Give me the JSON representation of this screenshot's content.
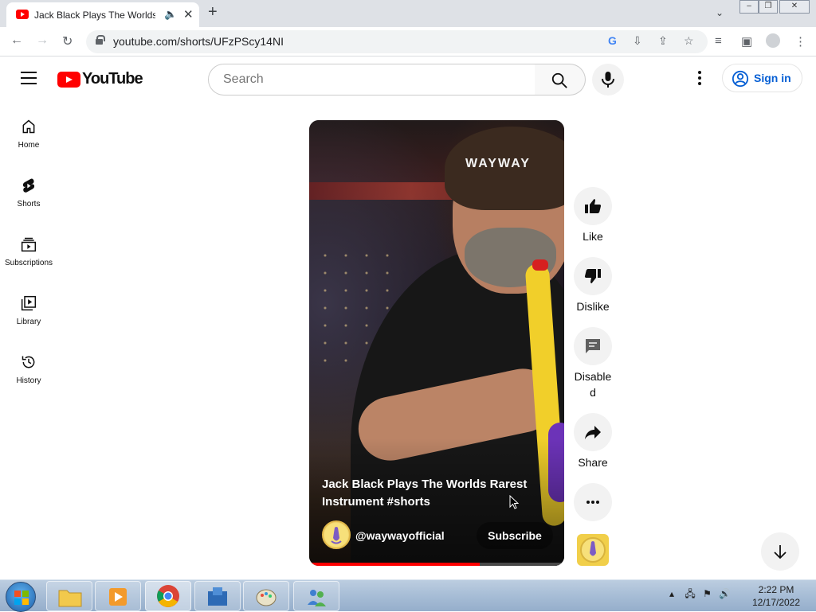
{
  "browser": {
    "tab_title": "Jack Black Plays The Worlds Rarest Instrument",
    "url": "youtube.com/shorts/UFzPScy14NI",
    "new_tab_glyph": "+",
    "close_tab_glyph": "✕"
  },
  "header": {
    "logo_text": "YouTube",
    "search_placeholder": "Search",
    "sign_in": "Sign in"
  },
  "sidebar": {
    "items": [
      {
        "label": "Home",
        "icon": "home-icon"
      },
      {
        "label": "Shorts",
        "icon": "shorts-icon"
      },
      {
        "label": "Subscriptions",
        "icon": "subscriptions-icon"
      },
      {
        "label": "Library",
        "icon": "library-icon"
      },
      {
        "label": "History",
        "icon": "history-icon"
      }
    ]
  },
  "short": {
    "watermark": "WAYWAY",
    "title": "Jack Black Plays The Worlds Rarest Instrument #shorts",
    "channel": "@waywayofficial",
    "subscribe": "Subscribe",
    "progress": 0.67
  },
  "actions": {
    "like": "Like",
    "dislike": "Dislike",
    "comments": "Disable d",
    "share": "Share"
  },
  "taskbar": {
    "time": "2:22 PM",
    "date": "12/17/2022"
  },
  "colors": {
    "brand_red": "#ff0000",
    "link_blue": "#065fd4"
  }
}
